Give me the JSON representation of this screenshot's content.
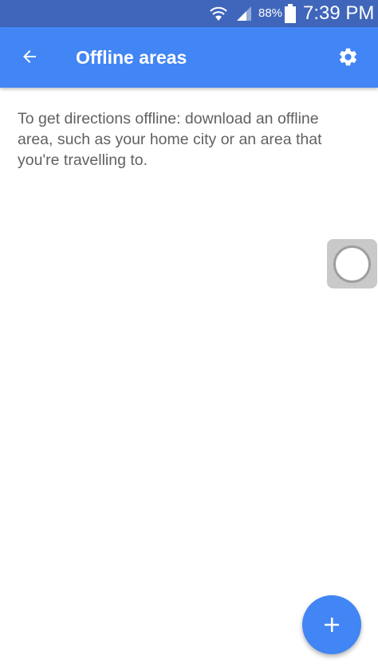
{
  "status_bar": {
    "battery_percent": "88%",
    "time": "7:39 PM",
    "icons": [
      "wifi-icon",
      "signal-icon",
      "battery-icon"
    ]
  },
  "app_bar": {
    "title": "Offline areas",
    "back_icon": "arrow-back-icon",
    "settings_icon": "gear-icon",
    "color": "#4285f4"
  },
  "content": {
    "description": "To get directions offline: download an offline area, such as your home city or an area that you're travelling to."
  },
  "fab": {
    "icon": "plus-icon",
    "color": "#4285f4"
  },
  "assistive_touch": {
    "icon": "assistive-touch-icon"
  }
}
